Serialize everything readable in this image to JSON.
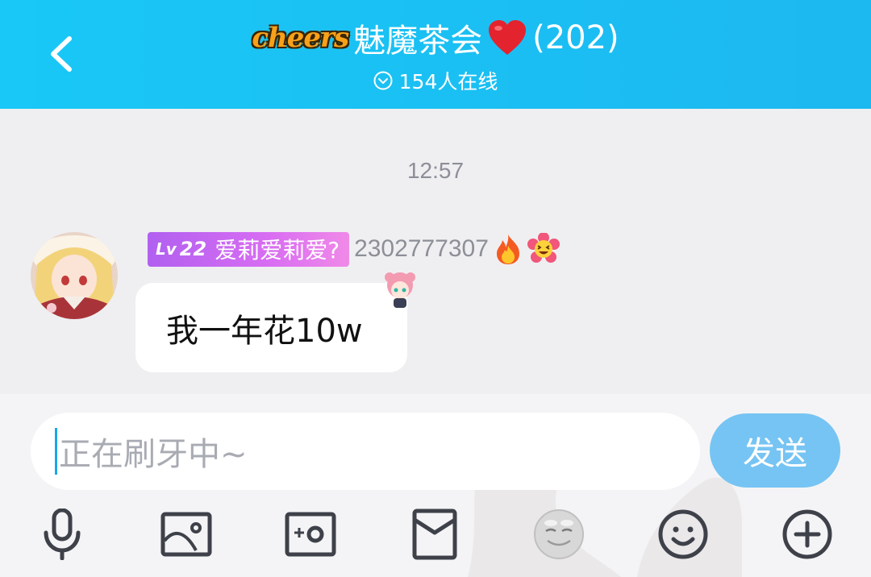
{
  "header": {
    "logo_text": "cheers",
    "group_name": "魅魔茶会",
    "member_count": "(202)",
    "online_text": "154人在线"
  },
  "chat": {
    "timestamp": "12:57",
    "messages": [
      {
        "level_prefix": "Lv",
        "level": "22",
        "member_title": "爱莉爱莉爱?",
        "user_id": "2302777307",
        "text": "我一年花10w"
      }
    ]
  },
  "input": {
    "placeholder": "正在刷牙中~",
    "send_label": "发送"
  },
  "toolbar": {
    "icons": [
      "microphone-icon",
      "image-icon",
      "camera-icon",
      "red-packet-icon",
      "face-sticker-icon",
      "emoji-icon",
      "plus-icon"
    ]
  },
  "colors": {
    "header_bg": "#19c8f6",
    "send_button": "#76c4f3",
    "level_badge_start": "#b160f0",
    "level_badge_end": "#f08ae8",
    "caret": "#1aa6e6"
  }
}
